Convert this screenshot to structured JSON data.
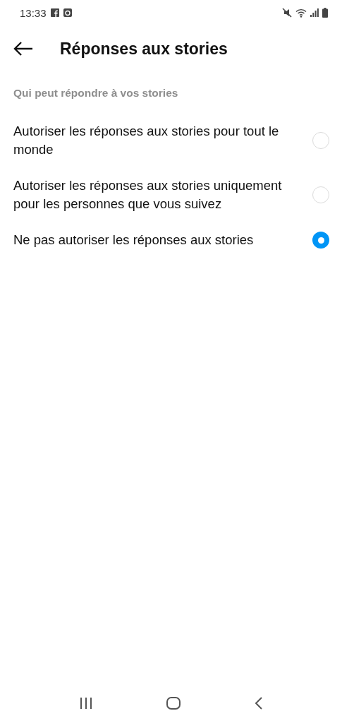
{
  "status_bar": {
    "time": "13:33"
  },
  "header": {
    "title": "Réponses aux stories"
  },
  "section": {
    "label": "Qui peut répondre à vos stories"
  },
  "options": [
    {
      "label": "Autoriser les réponses aux stories pour tout le monde",
      "selected": false
    },
    {
      "label": "Autoriser les réponses aux stories uniquement pour les personnes que vous suivez",
      "selected": false
    },
    {
      "label": "Ne pas autoriser les réponses aux stories",
      "selected": true
    }
  ]
}
